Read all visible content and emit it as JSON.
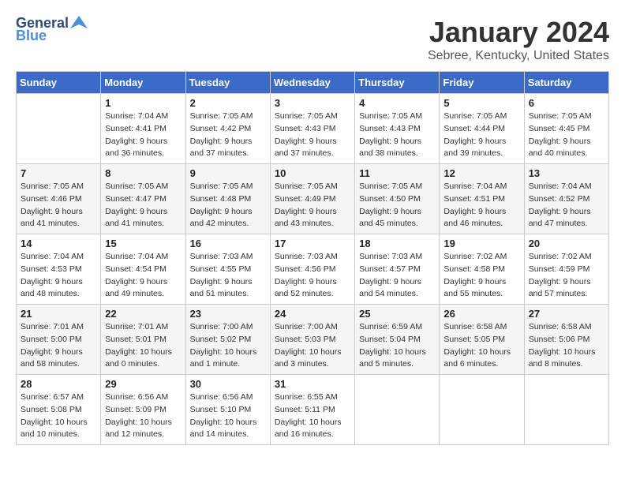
{
  "header": {
    "logo_line1": "General",
    "logo_line2": "Blue",
    "title": "January 2024",
    "location": "Sebree, Kentucky, United States"
  },
  "weekdays": [
    "Sunday",
    "Monday",
    "Tuesday",
    "Wednesday",
    "Thursday",
    "Friday",
    "Saturday"
  ],
  "weeks": [
    [
      {
        "day": "",
        "info": ""
      },
      {
        "day": "1",
        "info": "Sunrise: 7:04 AM\nSunset: 4:41 PM\nDaylight: 9 hours\nand 36 minutes."
      },
      {
        "day": "2",
        "info": "Sunrise: 7:05 AM\nSunset: 4:42 PM\nDaylight: 9 hours\nand 37 minutes."
      },
      {
        "day": "3",
        "info": "Sunrise: 7:05 AM\nSunset: 4:43 PM\nDaylight: 9 hours\nand 37 minutes."
      },
      {
        "day": "4",
        "info": "Sunrise: 7:05 AM\nSunset: 4:43 PM\nDaylight: 9 hours\nand 38 minutes."
      },
      {
        "day": "5",
        "info": "Sunrise: 7:05 AM\nSunset: 4:44 PM\nDaylight: 9 hours\nand 39 minutes."
      },
      {
        "day": "6",
        "info": "Sunrise: 7:05 AM\nSunset: 4:45 PM\nDaylight: 9 hours\nand 40 minutes."
      }
    ],
    [
      {
        "day": "7",
        "info": "Sunrise: 7:05 AM\nSunset: 4:46 PM\nDaylight: 9 hours\nand 41 minutes."
      },
      {
        "day": "8",
        "info": "Sunrise: 7:05 AM\nSunset: 4:47 PM\nDaylight: 9 hours\nand 41 minutes."
      },
      {
        "day": "9",
        "info": "Sunrise: 7:05 AM\nSunset: 4:48 PM\nDaylight: 9 hours\nand 42 minutes."
      },
      {
        "day": "10",
        "info": "Sunrise: 7:05 AM\nSunset: 4:49 PM\nDaylight: 9 hours\nand 43 minutes."
      },
      {
        "day": "11",
        "info": "Sunrise: 7:05 AM\nSunset: 4:50 PM\nDaylight: 9 hours\nand 45 minutes."
      },
      {
        "day": "12",
        "info": "Sunrise: 7:04 AM\nSunset: 4:51 PM\nDaylight: 9 hours\nand 46 minutes."
      },
      {
        "day": "13",
        "info": "Sunrise: 7:04 AM\nSunset: 4:52 PM\nDaylight: 9 hours\nand 47 minutes."
      }
    ],
    [
      {
        "day": "14",
        "info": "Sunrise: 7:04 AM\nSunset: 4:53 PM\nDaylight: 9 hours\nand 48 minutes."
      },
      {
        "day": "15",
        "info": "Sunrise: 7:04 AM\nSunset: 4:54 PM\nDaylight: 9 hours\nand 49 minutes."
      },
      {
        "day": "16",
        "info": "Sunrise: 7:03 AM\nSunset: 4:55 PM\nDaylight: 9 hours\nand 51 minutes."
      },
      {
        "day": "17",
        "info": "Sunrise: 7:03 AM\nSunset: 4:56 PM\nDaylight: 9 hours\nand 52 minutes."
      },
      {
        "day": "18",
        "info": "Sunrise: 7:03 AM\nSunset: 4:57 PM\nDaylight: 9 hours\nand 54 minutes."
      },
      {
        "day": "19",
        "info": "Sunrise: 7:02 AM\nSunset: 4:58 PM\nDaylight: 9 hours\nand 55 minutes."
      },
      {
        "day": "20",
        "info": "Sunrise: 7:02 AM\nSunset: 4:59 PM\nDaylight: 9 hours\nand 57 minutes."
      }
    ],
    [
      {
        "day": "21",
        "info": "Sunrise: 7:01 AM\nSunset: 5:00 PM\nDaylight: 9 hours\nand 58 minutes."
      },
      {
        "day": "22",
        "info": "Sunrise: 7:01 AM\nSunset: 5:01 PM\nDaylight: 10 hours\nand 0 minutes."
      },
      {
        "day": "23",
        "info": "Sunrise: 7:00 AM\nSunset: 5:02 PM\nDaylight: 10 hours\nand 1 minute."
      },
      {
        "day": "24",
        "info": "Sunrise: 7:00 AM\nSunset: 5:03 PM\nDaylight: 10 hours\nand 3 minutes."
      },
      {
        "day": "25",
        "info": "Sunrise: 6:59 AM\nSunset: 5:04 PM\nDaylight: 10 hours\nand 5 minutes."
      },
      {
        "day": "26",
        "info": "Sunrise: 6:58 AM\nSunset: 5:05 PM\nDaylight: 10 hours\nand 6 minutes."
      },
      {
        "day": "27",
        "info": "Sunrise: 6:58 AM\nSunset: 5:06 PM\nDaylight: 10 hours\nand 8 minutes."
      }
    ],
    [
      {
        "day": "28",
        "info": "Sunrise: 6:57 AM\nSunset: 5:08 PM\nDaylight: 10 hours\nand 10 minutes."
      },
      {
        "day": "29",
        "info": "Sunrise: 6:56 AM\nSunset: 5:09 PM\nDaylight: 10 hours\nand 12 minutes."
      },
      {
        "day": "30",
        "info": "Sunrise: 6:56 AM\nSunset: 5:10 PM\nDaylight: 10 hours\nand 14 minutes."
      },
      {
        "day": "31",
        "info": "Sunrise: 6:55 AM\nSunset: 5:11 PM\nDaylight: 10 hours\nand 16 minutes."
      },
      {
        "day": "",
        "info": ""
      },
      {
        "day": "",
        "info": ""
      },
      {
        "day": "",
        "info": ""
      }
    ]
  ]
}
